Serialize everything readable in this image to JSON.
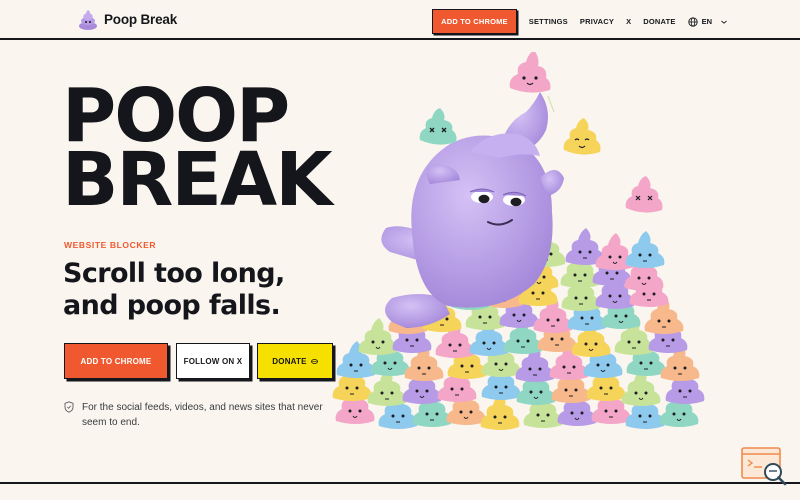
{
  "header": {
    "brand_name": "Poop Break",
    "nav": {
      "add_to_chrome": "ADD TO CHROME",
      "settings": "SETTINGS",
      "privacy": "PRIVACY",
      "x": "X",
      "donate": "DONATE",
      "language": "EN"
    }
  },
  "hero": {
    "title_line1": "POOP",
    "title_line2": "BREAK",
    "eyebrow": "WEBSITE BLOCKER",
    "subtitle_line1": "Scroll too long,",
    "subtitle_line2": "and poop falls.",
    "buttons": {
      "add_to_chrome": "ADD TO CHROME",
      "follow_on_x": "FOLLOW ON X",
      "donate": "DONATE"
    },
    "note": "For the social feeds, videos, and news sites that never seem to end."
  },
  "colors": {
    "background": "#faf6ef",
    "accent_orange": "#f0592f",
    "donate_yellow": "#f6e000",
    "ink": "#15171c",
    "mascot_purple": "#b79be6"
  },
  "icons": {
    "brand": "poop-mascot-logo",
    "language": "globe-icon",
    "dropdown": "chevron-down-icon",
    "donate": "coin-icon",
    "note": "shield-icon",
    "widget": "search-window-icon"
  }
}
